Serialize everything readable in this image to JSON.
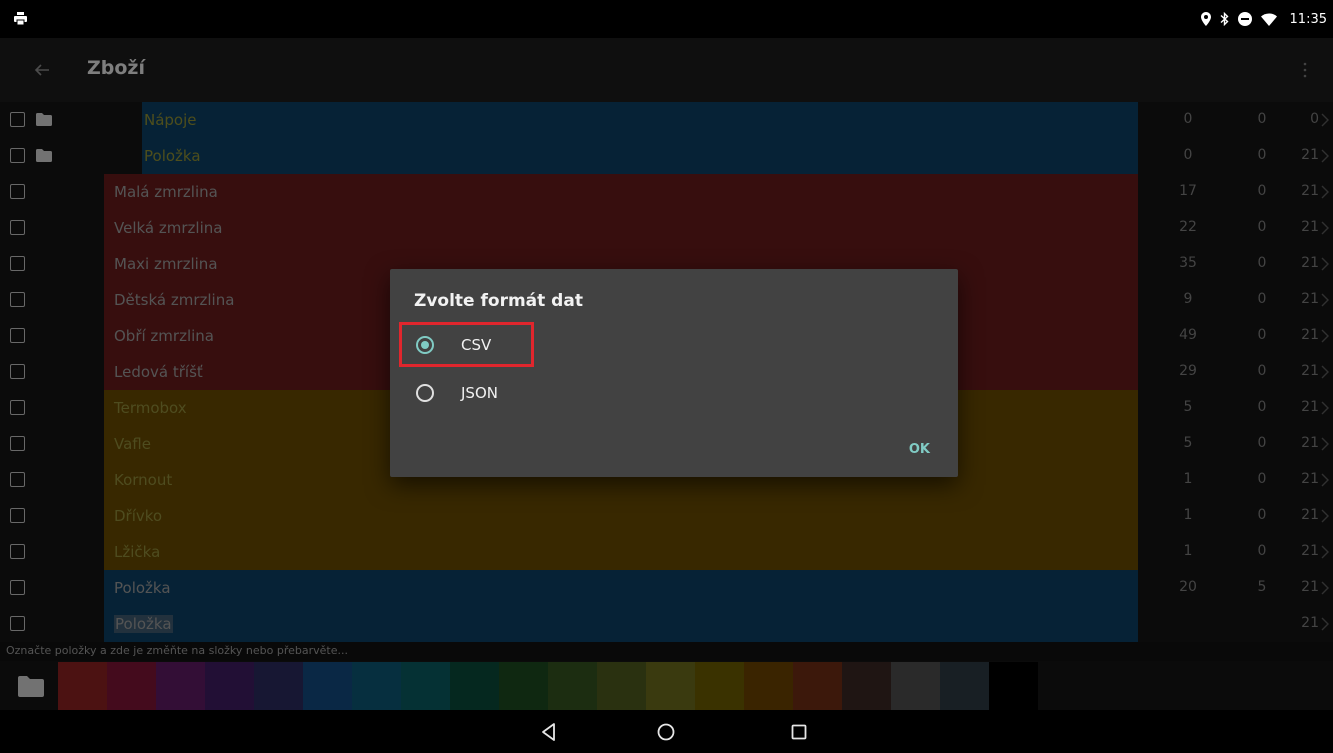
{
  "status_bar": {
    "time": "11:35",
    "icons": [
      "printer-icon",
      "location-icon",
      "bluetooth-icon",
      "do-not-disturb-icon",
      "wifi-icon"
    ]
  },
  "action_bar": {
    "title": "Zboží",
    "back_icon": "arrow-left-icon",
    "menu_icon": "more-vert-icon"
  },
  "colors": {
    "blue": "#0b3f63",
    "red": "#641b1b",
    "yellow": "#664a00",
    "accent": "#80cbc4"
  },
  "rows": [
    {
      "name": "Nápoje",
      "folder": true,
      "band": "blue",
      "text_color": "#8f8f33",
      "c1": "0",
      "c2": "0",
      "c3": "0"
    },
    {
      "name": "Položka",
      "folder": true,
      "band": "blue",
      "text_color": "#8f8f33",
      "c1": "0",
      "c2": "0",
      "c3": "21"
    },
    {
      "name": "Malá zmrzlina",
      "folder": false,
      "band": "red",
      "text_color": "#9a9a9a",
      "c1": "17",
      "c2": "0",
      "c3": "21"
    },
    {
      "name": "Velká zmrzlina",
      "folder": false,
      "band": "red",
      "text_color": "#9a9a9a",
      "c1": "22",
      "c2": "0",
      "c3": "21"
    },
    {
      "name": "Maxi zmrzlina",
      "folder": false,
      "band": "red",
      "text_color": "#9a9a9a",
      "c1": "35",
      "c2": "0",
      "c3": "21"
    },
    {
      "name": "Dětská zmrzlina",
      "folder": false,
      "band": "red",
      "text_color": "#9a9a9a",
      "c1": "9",
      "c2": "0",
      "c3": "21"
    },
    {
      "name": "Obří zmrzlina",
      "folder": false,
      "band": "red",
      "text_color": "#9a9a9a",
      "c1": "49",
      "c2": "0",
      "c3": "21"
    },
    {
      "name": "Ledová tříšť",
      "folder": false,
      "band": "red",
      "text_color": "#9a9a9a",
      "c1": "29",
      "c2": "0",
      "c3": "21"
    },
    {
      "name": "Termobox",
      "folder": false,
      "band": "yellow",
      "text_color": "#8f8a3a",
      "c1": "5",
      "c2": "0",
      "c3": "21"
    },
    {
      "name": "Vafle",
      "folder": false,
      "band": "yellow",
      "text_color": "#8f8a3a",
      "c1": "5",
      "c2": "0",
      "c3": "21"
    },
    {
      "name": "Kornout",
      "folder": false,
      "band": "yellow",
      "text_color": "#8f8a3a",
      "c1": "1",
      "c2": "0",
      "c3": "21"
    },
    {
      "name": "Dřívko",
      "folder": false,
      "band": "yellow",
      "text_color": "#8f8a3a",
      "c1": "1",
      "c2": "0",
      "c3": "21"
    },
    {
      "name": "Lžička",
      "folder": false,
      "band": "yellow",
      "text_color": "#8f8a3a",
      "c1": "1",
      "c2": "0",
      "c3": "21"
    },
    {
      "name": "Položka",
      "folder": false,
      "band": "blue",
      "text_color": "#9a9a9a",
      "c1": "20",
      "c2": "5",
      "c3": "21"
    },
    {
      "name": "Položka",
      "folder": false,
      "band": "blue",
      "text_color": "#9a9a9a",
      "c1": "",
      "c2": "",
      "c3": "21",
      "selected": true
    }
  ],
  "hint": "Označte položky a zde je změňte na složky nebo přebarvěte...",
  "palette": [
    "#8b2222",
    "#7d1536",
    "#5e1b63",
    "#3f1c61",
    "#2a2a5e",
    "#134a7e",
    "#0c5673",
    "#0a5a5f",
    "#0a4a39",
    "#1c4a1f",
    "#33521f",
    "#4d5a1e",
    "#6a6a1c",
    "#6a5c00",
    "#6a4300",
    "#6e2c14",
    "#3a2723",
    "#4e4e4e",
    "#2d3a42",
    "#000000"
  ],
  "dialog": {
    "title": "Zvolte formát dat",
    "options": [
      {
        "label": "CSV",
        "selected": true
      },
      {
        "label": "JSON",
        "selected": false
      }
    ],
    "ok_label": "OK"
  },
  "nav_bar": {
    "icons": [
      "back-triangle-icon",
      "home-circle-icon",
      "recents-square-icon"
    ]
  }
}
